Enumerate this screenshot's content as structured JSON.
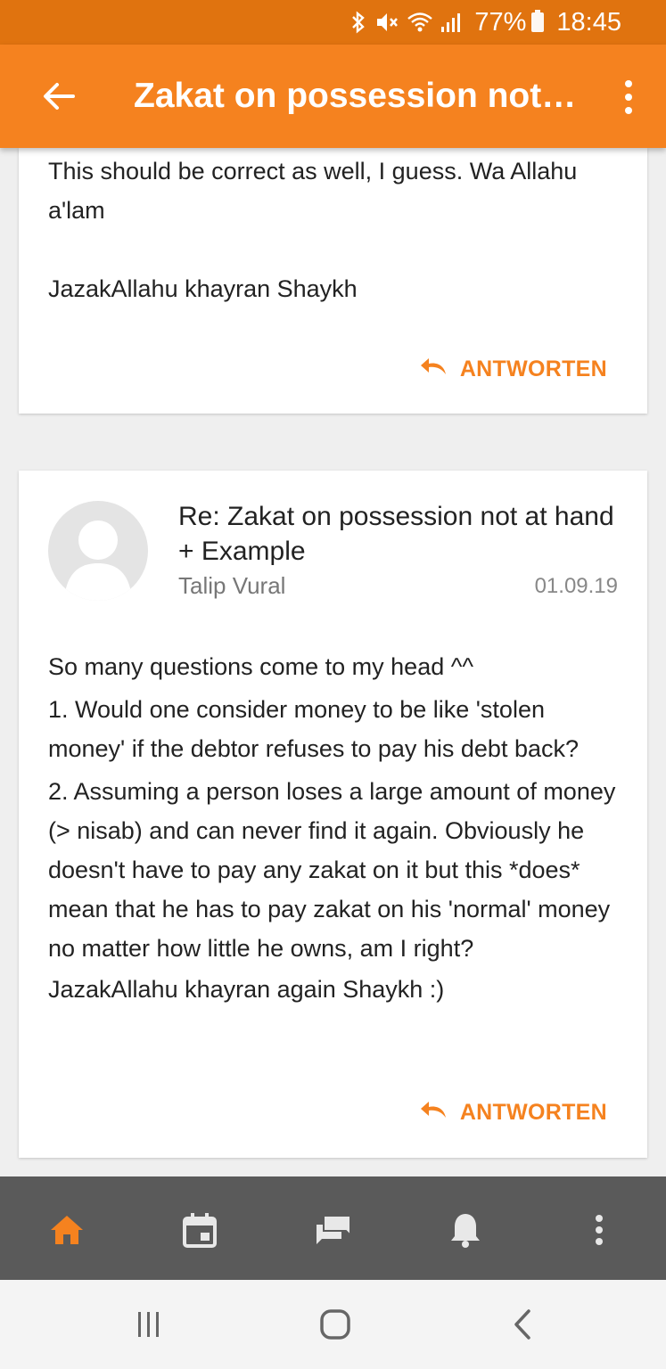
{
  "status_bar": {
    "battery": "77%",
    "time": "18:45",
    "icons": [
      "bluetooth-icon",
      "mute-icon",
      "wifi-icon",
      "signal-icon",
      "battery-icon"
    ]
  },
  "app_bar": {
    "title": "Zakat on possession not at hand + Example",
    "back_icon": "back-arrow-icon",
    "menu_icon": "more-vert-icon"
  },
  "posts": [
    {
      "body": [
        "This should be correct as well, I guess. Wa Allahu a'lam",
        "",
        "JazakAllahu khayran Shaykh"
      ],
      "reply_label": "ANTWORTEN"
    },
    {
      "title": "Re: Zakat on possession not at hand + Example",
      "author": "Talip Vural",
      "date": "01.09.19",
      "body": [
        "So many questions come to my head ^^",
        "1. Would one consider money to be like 'stolen money' if the debtor refuses to pay his debt back?",
        "2. Assuming a person loses a large amount of money (> nisab) and can never find it again. Obviously he doesn't have to pay any zakat on it but this *does* mean that he has to pay zakat on his 'normal' money no matter how little he owns, am I right?",
        "JazakAllahu khayran again Shaykh :)"
      ],
      "reply_label": "ANTWORTEN"
    }
  ],
  "bottom_nav": {
    "items": [
      "home-icon",
      "calendar-icon",
      "forum-icon",
      "notifications-icon",
      "more-vert-icon"
    ],
    "active": "home-icon"
  },
  "system_nav": [
    "recent-apps-icon",
    "home-button-icon",
    "back-icon"
  ],
  "colors": {
    "status_bar": "#e0730f",
    "app_bar": "#f5821f",
    "accent": "#f5821f",
    "bottom_nav": "#5a5a5a"
  }
}
